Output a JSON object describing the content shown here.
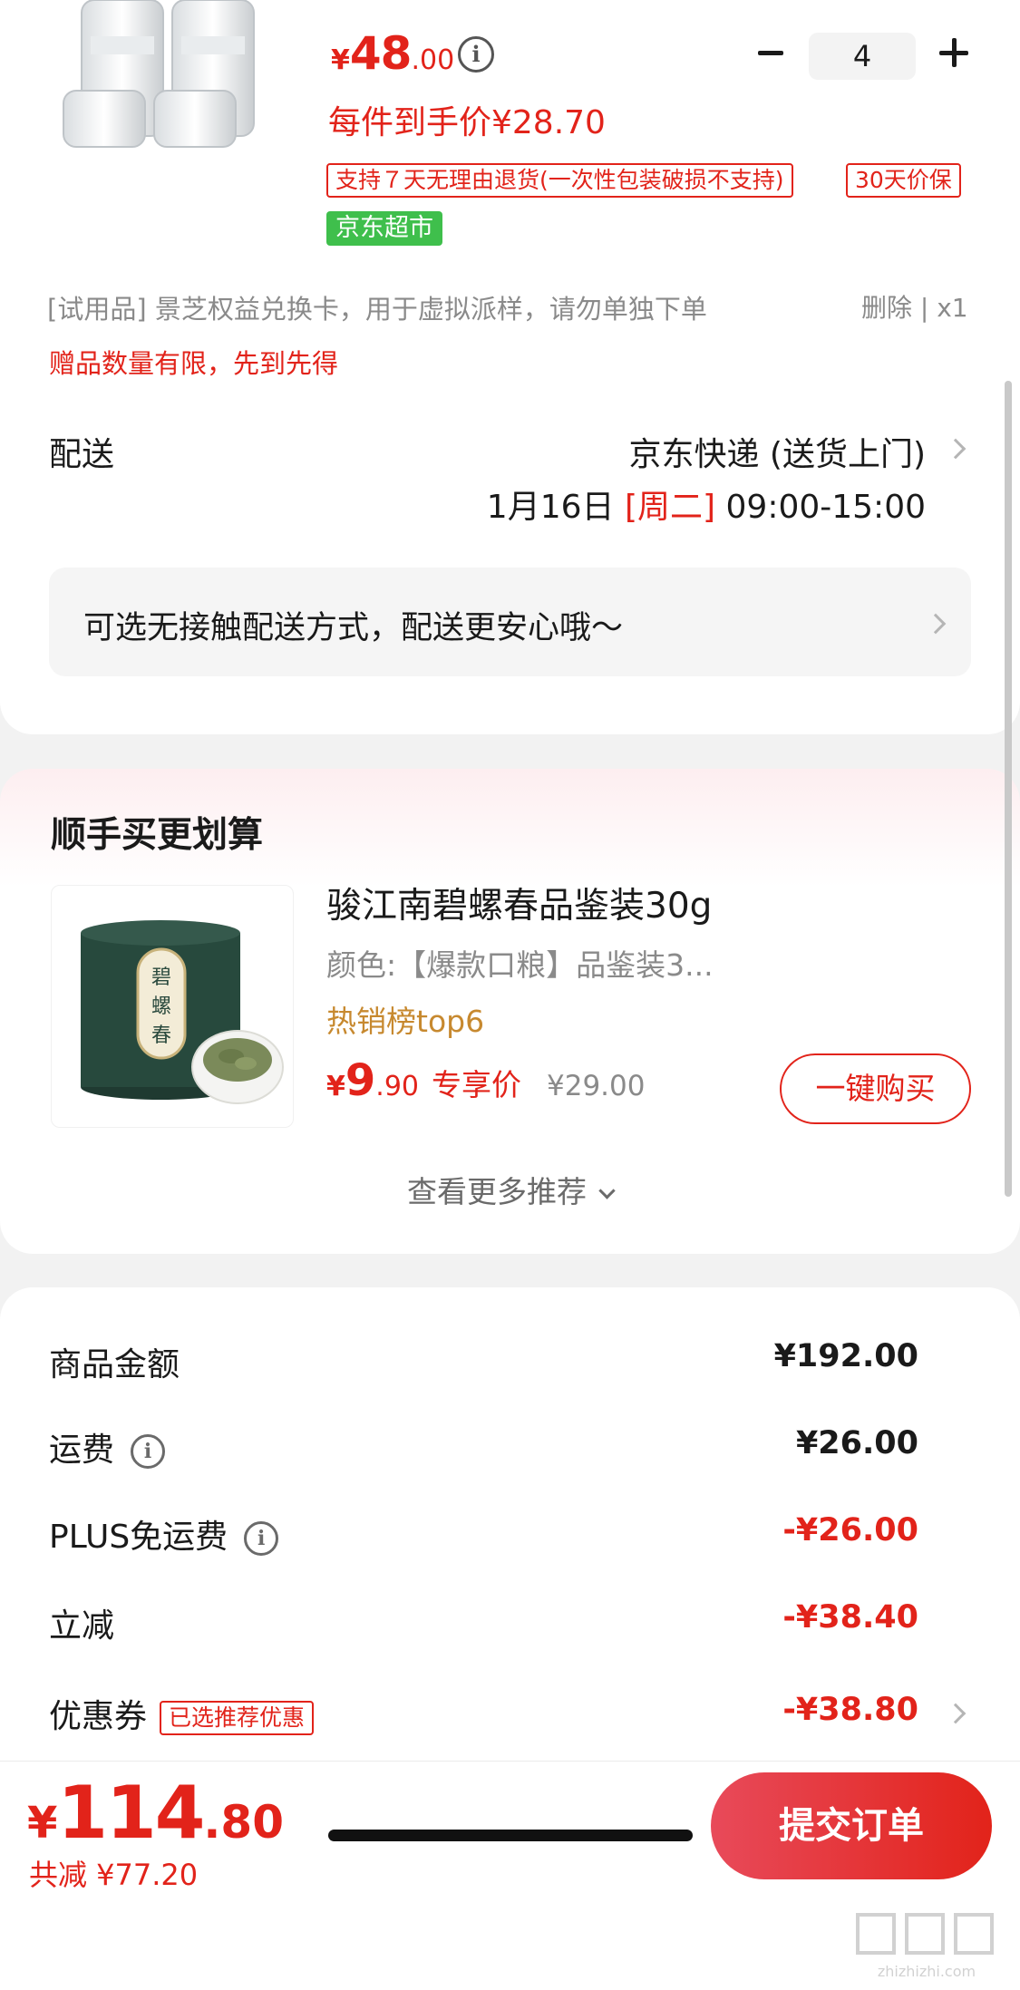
{
  "product": {
    "price_currency": "¥",
    "price_integer": "48",
    "price_decimal": ".00",
    "info_icon": "info-icon",
    "quantity": "4",
    "per_piece_price": "每件到手价¥28.70",
    "tags": {
      "return_policy": "支持７天无理由退货(一次性包装破损不支持)",
      "price_protect": "30天价保",
      "market": "京东超市"
    }
  },
  "trial": {
    "item_text": "[试用品] 景芝权益兑换卡，用于虚拟派样，请勿单独下单",
    "actions": "删除 | x1",
    "gift_note": "赠品数量有限，先到先得"
  },
  "delivery": {
    "label": "配送",
    "method": "京东快递 (送货上门)",
    "date": "1月16日",
    "weekday": "[周二]",
    "time": "09:00-15:00",
    "contactless_text": "可选无接触配送方式，配送更安心哦～"
  },
  "recommend": {
    "title": "顺手买更划算",
    "item": {
      "name": "骏江南碧螺春品鉴装30g",
      "variant": "颜色:【爆款口粮】品鉴装3...",
      "rank": "热销榜top6",
      "price_currency": "¥",
      "price_integer": "9",
      "price_decimal": ".90",
      "price_label": "专享价",
      "original_price": "¥29.00",
      "buy_label": "一键购买",
      "can_text": "碧螺春"
    },
    "more_label": "查看更多推荐"
  },
  "summary": {
    "rows": [
      {
        "label": "商品金额",
        "value": "¥192.00"
      },
      {
        "label": "运费",
        "value": "¥26.00"
      },
      {
        "label": "PLUS免运费",
        "value": "-¥26.00"
      },
      {
        "label": "立减",
        "value": "-¥38.40"
      },
      {
        "label": "优惠券",
        "value": "-¥38.80",
        "tag": "已选推荐优惠"
      }
    ]
  },
  "footer": {
    "total_currency": "¥",
    "total_integer": "114",
    "total_decimal": ".80",
    "saved_text": "共减 ¥77.20",
    "submit_label": "提交订单"
  },
  "watermark": {
    "text": "zhizhizhi.com"
  },
  "colors": {
    "accent_red": "#e2231a",
    "market_green": "#3fbf4c",
    "rank_gold": "#c7892f"
  }
}
